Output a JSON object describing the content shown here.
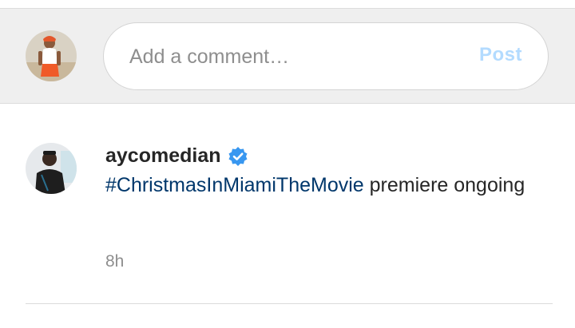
{
  "composer": {
    "placeholder": "Add a comment…",
    "post_label": "Post"
  },
  "caption": {
    "username": "aycomedian",
    "verified": true,
    "hashtag": "#ChristmasInMiamiTheMovie",
    "text": " premiere ongoing",
    "timestamp": "8h"
  },
  "colors": {
    "link": "#00376b",
    "post_disabled": "#b3dbff",
    "verified_badge": "#3897f0"
  },
  "icons": [
    "user-avatar-icon",
    "author-avatar-icon",
    "verified-badge-icon"
  ]
}
